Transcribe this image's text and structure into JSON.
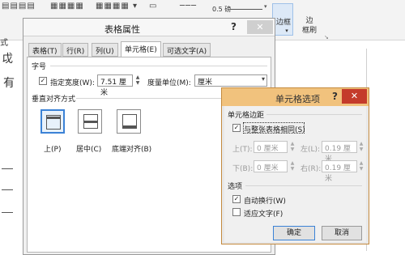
{
  "ribbon": {
    "border_weight": "0.5 磅",
    "borders_button": "边框",
    "border_painter_button_line1": "边",
    "border_painter_button_line2": "框刷",
    "dropdown_glyph": "▾",
    "expand_glyph": "↘"
  },
  "document": {
    "left_chars": [
      "式",
      "戉",
      "有"
    ]
  },
  "table_properties": {
    "title": "表格属性",
    "help": "?",
    "close": "✕",
    "tabs": [
      "表格(T)",
      "行(R)",
      "列(U)",
      "单元格(E)",
      "可选文字(A)"
    ],
    "active_tab_index": 3,
    "size_section": "字号",
    "preferred_width_checkbox": "指定宽度(W):",
    "preferred_width_checked": true,
    "width_value": "7.51 厘米",
    "measure_label": "度量单位(M):",
    "measure_value": "厘米",
    "vertical_alignment_section": "垂直对齐方式",
    "align_options": [
      "上(P)",
      "居中(C)",
      "底端对齐(B)"
    ],
    "align_selected_index": 0
  },
  "cell_options": {
    "title": "单元格选项",
    "help": "?",
    "close": "✕",
    "margins_section": "单元格边距",
    "same_as_table_checkbox": "与整张表格相同(S)",
    "same_as_table_checked": true,
    "top_label": "上(T):",
    "top_value": "0 厘米",
    "left_label": "左(L):",
    "left_value": "0.19 厘米",
    "bottom_label": "下(B):",
    "bottom_value": "0 厘米",
    "right_label": "右(R):",
    "right_value": "0.19 厘米",
    "options_section": "选项",
    "wrap_text_checkbox": "自动换行(W)",
    "wrap_text_checked": true,
    "fit_text_checkbox": "适应文字(F)",
    "fit_text_checked": false,
    "ok_button": "确定",
    "cancel_button": "取消"
  }
}
